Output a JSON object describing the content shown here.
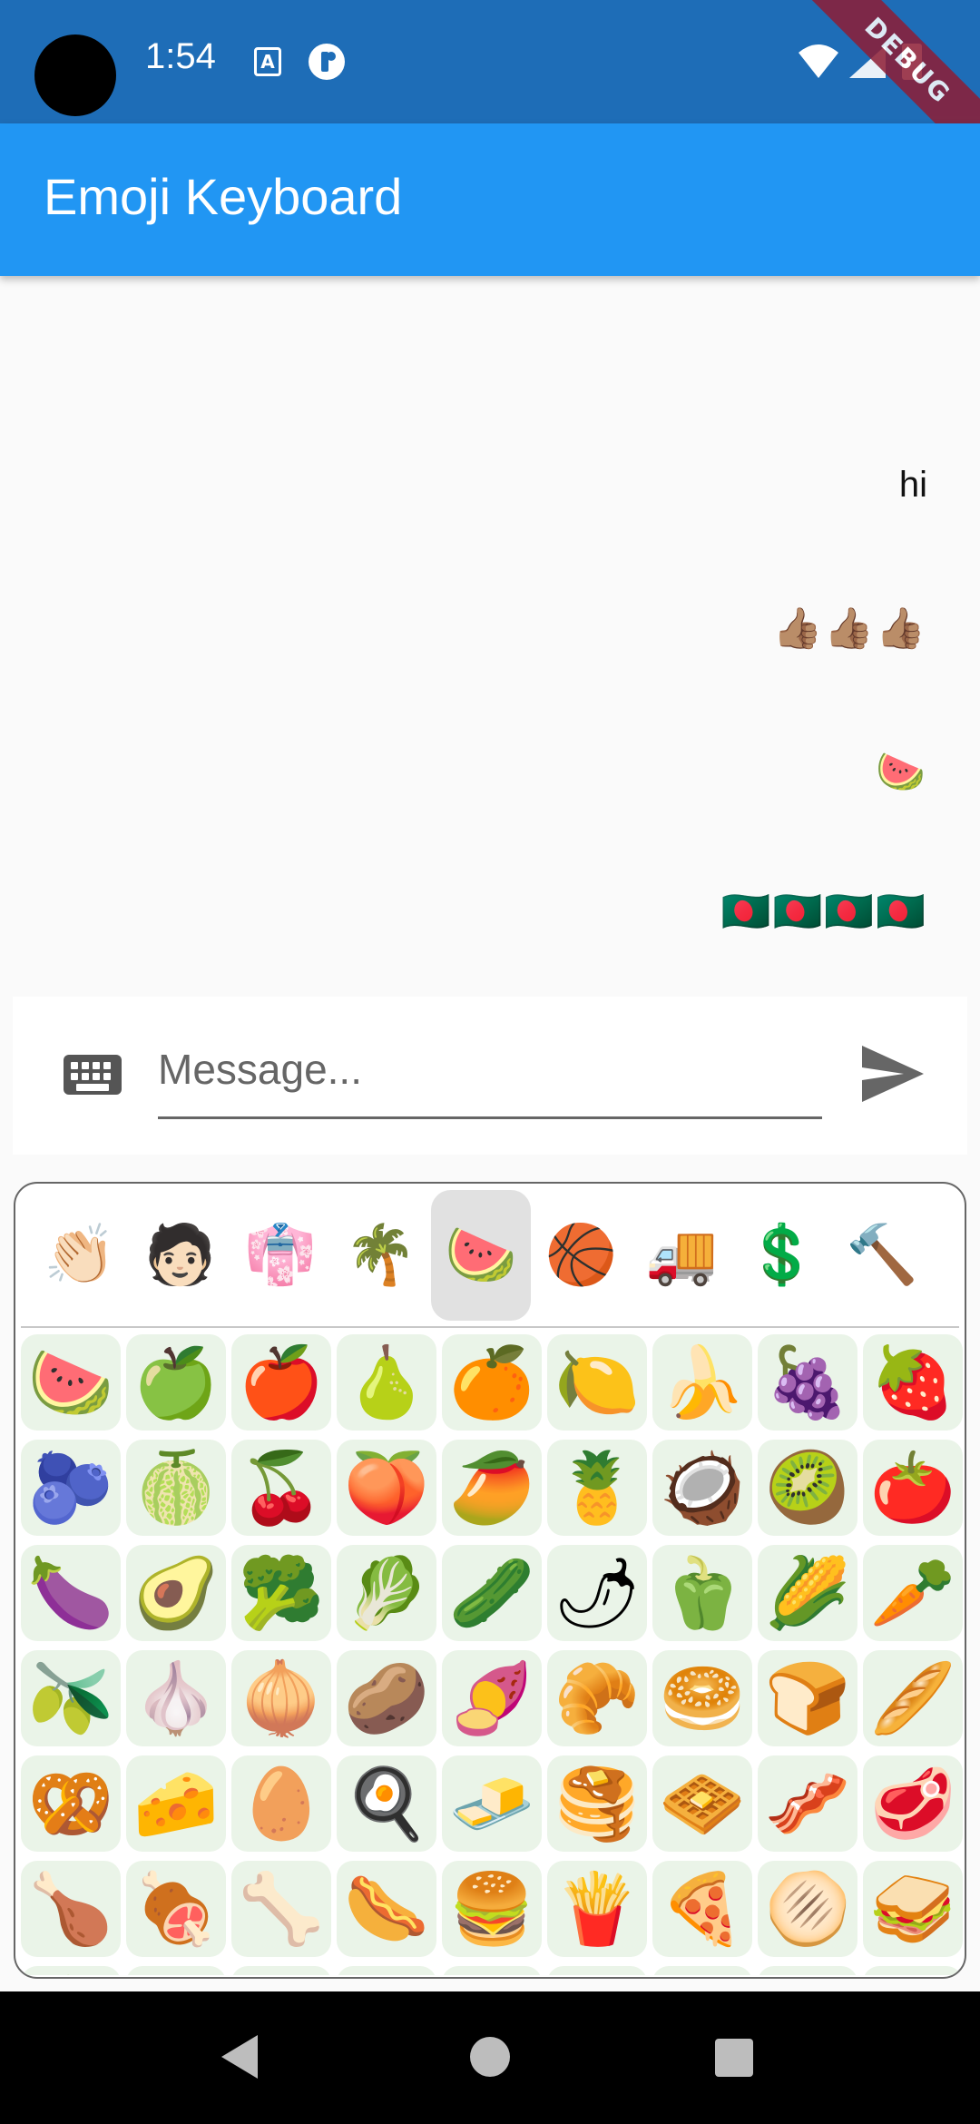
{
  "status_bar": {
    "time": "1:54",
    "app_icon_a": "A",
    "debug_label": "DEBUG",
    "icons": [
      "camera-cutout",
      "accessibility-a-icon",
      "app-r-icon",
      "wifi-icon",
      "signal-icon",
      "battery-icon"
    ]
  },
  "app_bar": {
    "title": "Emoji Keyboard"
  },
  "messages": [
    {
      "text": "hi"
    },
    {
      "text": "👍🏽👍🏽👍🏽"
    },
    {
      "text": "🍉"
    },
    {
      "text": "🇧🇩🇧🇩🇧🇩🇧🇩"
    }
  ],
  "input_bar": {
    "placeholder": "Message...",
    "value": "",
    "icons": [
      "keyboard-icon",
      "send-icon"
    ]
  },
  "emoji_picker": {
    "categories": [
      {
        "icon": "👏🏻",
        "name": "smileys-people"
      },
      {
        "icon": "🧑🏻",
        "name": "people"
      },
      {
        "icon": "👘",
        "name": "clothing"
      },
      {
        "icon": "🌴",
        "name": "animals-nature"
      },
      {
        "icon": "🍉",
        "name": "food-drink",
        "selected": true
      },
      {
        "icon": "🏀",
        "name": "activities"
      },
      {
        "icon": "🚚",
        "name": "travel-places"
      },
      {
        "icon": "💲",
        "name": "symbols"
      },
      {
        "icon": "🔨",
        "name": "objects"
      }
    ],
    "emojis": [
      "🍉",
      "🍏",
      "🍎",
      "🍐",
      "🍊",
      "🍋",
      "🍌",
      "🍇",
      "🍓",
      "🫐",
      "🍈",
      "🍒",
      "🍑",
      "🥭",
      "🍍",
      "🥥",
      "🥝",
      "🍅",
      "🍆",
      "🥑",
      "🥦",
      "🥬",
      "🥒",
      "🌶",
      "🫑",
      "🌽",
      "🥕",
      "🫒",
      "🧄",
      "🧅",
      "🥔",
      "🍠",
      "🥐",
      "🥯",
      "🍞",
      "🥖",
      "🥨",
      "🧀",
      "🥚",
      "🍳",
      "🧈",
      "🥞",
      "🧇",
      "🥓",
      "🥩",
      "🍗",
      "🍖",
      "🦴",
      "🌭",
      "🍔",
      "🍟",
      "🍕",
      "🫓",
      "🥪",
      "🥙",
      "🧆",
      "🌮",
      "🌯",
      "🫔",
      "🥗",
      "🥘",
      "🫕",
      "🥫"
    ]
  },
  "nav_bar": {
    "icons": [
      "back-icon",
      "home-icon",
      "recents-icon"
    ]
  },
  "colors": {
    "status_bar": "#1e6db7",
    "app_bar": "#2196f3",
    "background": "#fafafa",
    "emoji_cell": "#eaf4e8",
    "selected_tab": "#e1e1e1"
  }
}
